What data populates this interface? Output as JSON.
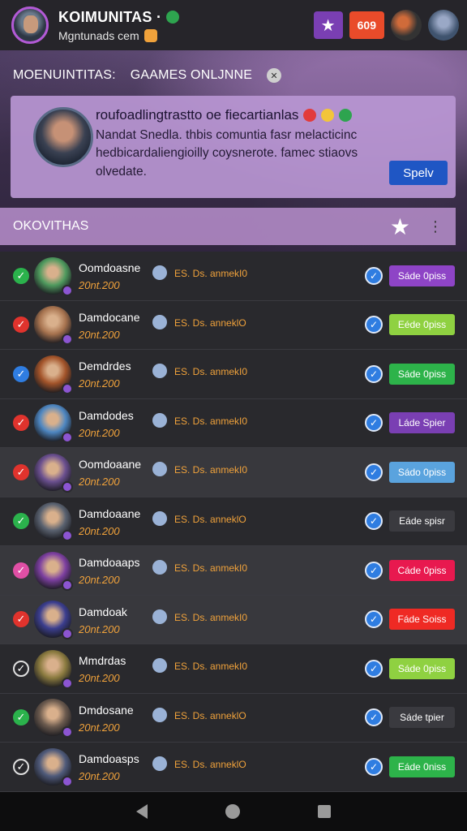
{
  "header": {
    "title": "KOIMUNITAS ·",
    "subtitle": "Mgntunads cem",
    "count_badge": "609"
  },
  "hero": {
    "heading_left": "MOENUINTITAS:",
    "heading_right": "GAAMES ONLJNNE"
  },
  "info_card": {
    "title": "roufoadlingtrastto oe fiecartianlas",
    "body": "Nandat Snedla. thbis comuntia fasr melacticinc hedbicardaliengioilly coysnerote. famec stiaovs olvedate.",
    "button_label": "Spelv"
  },
  "section": {
    "title": "OKOVITHAS"
  },
  "rows": [
    {
      "status": "green",
      "name": "Oomdoasne",
      "sub": "20nt.200",
      "meta": "ES. Ds. anmekI0",
      "action": "Sáde 0piss",
      "color": "#8e44c6",
      "avatar": "#4f9a5e",
      "alt": false
    },
    {
      "status": "red",
      "name": "Damdocane",
      "sub": "20nt.200",
      "meta": "ES. Ds. anneklO",
      "action": "Eéde 0piss",
      "color": "#8fd141",
      "avatar": "#a7734f",
      "alt": false
    },
    {
      "status": "blue",
      "name": "Demdrdes",
      "sub": "20nt.200",
      "meta": "ES. Ds. anmekI0",
      "action": "Sáde 0piss",
      "color": "#2db34a",
      "avatar": "#a3542a",
      "alt": false
    },
    {
      "status": "red",
      "name": "Damdodes",
      "sub": "20nt.200",
      "meta": "ES. Ds. anmekI0",
      "action": "Láde Spier",
      "color": "#7a3fb3",
      "avatar": "#4e87c2",
      "alt": false
    },
    {
      "status": "red",
      "name": "Oomdoaane",
      "sub": "20nt.200",
      "meta": "ES. Ds. anmekI0",
      "action": "Sádo 0piss",
      "color": "#5aa3de",
      "avatar": "#6a4f8f",
      "alt": true
    },
    {
      "status": "green",
      "name": "Damdoaane",
      "sub": "20nt.200",
      "meta": "ES. Ds. anneklO",
      "action": "Eáde spisr",
      "color": "#3a3a3f",
      "avatar": "#5a6270",
      "alt": false
    },
    {
      "status": "pink",
      "name": "Damdoaaps",
      "sub": "20nt.200",
      "meta": "ES. Ds. anmekI0",
      "action": "Cáde 0piss",
      "color": "#e8194f",
      "avatar": "#7c3fa0",
      "alt": true
    },
    {
      "status": "red",
      "name": "Damdoak",
      "sub": "20nt.200",
      "meta": "ES. Ds. anmekI0",
      "action": "Fáde Soiss",
      "color": "#ef2a24",
      "avatar": "#3b3e8f",
      "alt": true
    },
    {
      "status": "white",
      "name": "Mmdrdas",
      "sub": "20nt.200",
      "meta": "ES. Ds. anmekI0",
      "action": "Sáde 0piss",
      "color": "#8fd141",
      "avatar": "#8a7a3f",
      "alt": false
    },
    {
      "status": "green",
      "name": "Dmdosane",
      "sub": "20nt.200",
      "meta": "ES. Ds. anneklO",
      "action": "Sáde tpier",
      "color": "#3a3a3f",
      "avatar": "#6b5a4e",
      "alt": false
    },
    {
      "status": "white",
      "name": "Damdoasps",
      "sub": "20nt.200",
      "meta": "ES. Ds. anneklO",
      "action": "Eáde 0niss",
      "color": "#2db34a",
      "avatar": "#4f5a7a",
      "alt": false
    }
  ]
}
